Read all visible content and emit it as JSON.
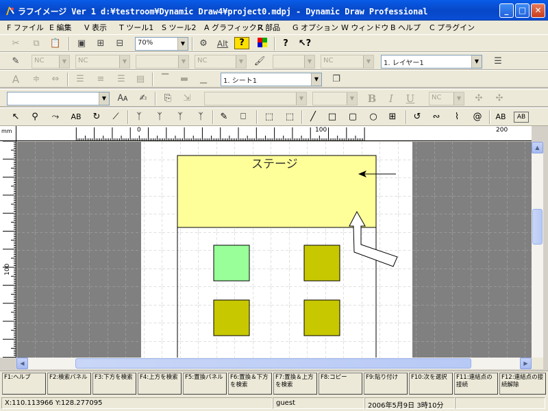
{
  "window": {
    "title": "ラフイメージ Ver 1 d:¥testroom¥Dynamic Draw4¥project0.mdpj - Dynamic Draw Professional"
  },
  "menu": [
    {
      "label": "F ファイル"
    },
    {
      "label": "E 編集"
    },
    {
      "label": "V 表示"
    },
    {
      "label": "T ツール1"
    },
    {
      "label": "S ツール2"
    },
    {
      "label": "A グラフィックス"
    },
    {
      "label": "R 部品"
    },
    {
      "label": "G オプション"
    },
    {
      "label": "W ウィンドウ"
    },
    {
      "label": "B ヘルプ"
    },
    {
      "label": "C プラグイン"
    }
  ],
  "toolbar": {
    "zoom": "70%",
    "alt_label": "Alt",
    "help_label": "?",
    "nc_label": "NC",
    "layer": "1. レイヤー1",
    "sheet": "1. シート1",
    "bold": "B",
    "italic": "I",
    "underline": "U",
    "font_tool_a": "A",
    "text_tool": "AB",
    "text_tool_2": "AB"
  },
  "ruler": {
    "unit": "mm",
    "h_labels": [
      "0",
      "100",
      "200"
    ],
    "v_labels": [
      "100"
    ]
  },
  "canvas": {
    "stage_label": "ステージ",
    "stage_color": "#ffff99",
    "green_square_color": "#99ff99",
    "olive_square_color": "#c8c800"
  },
  "function_keys": [
    {
      "label": "F1:ヘルプ"
    },
    {
      "label": "F2:検索パネル"
    },
    {
      "label": "F3:下方を検索"
    },
    {
      "label": "F4:上方を検索"
    },
    {
      "label": "F5:置換パネル"
    },
    {
      "label": "F6:置換＆下方を検索"
    },
    {
      "label": "F7:置換＆上方を検索"
    },
    {
      "label": "F8:コピー"
    },
    {
      "label": "F9:貼り付け"
    },
    {
      "label": "F10:次を選択"
    },
    {
      "label": "F11:連結点の接続"
    },
    {
      "label": "F12:連結点の接続解除"
    }
  ],
  "status": {
    "coords": "X:110.113966 Y:128.277095",
    "user": "guest",
    "datetime": "2006年5月9日  3時10分"
  }
}
